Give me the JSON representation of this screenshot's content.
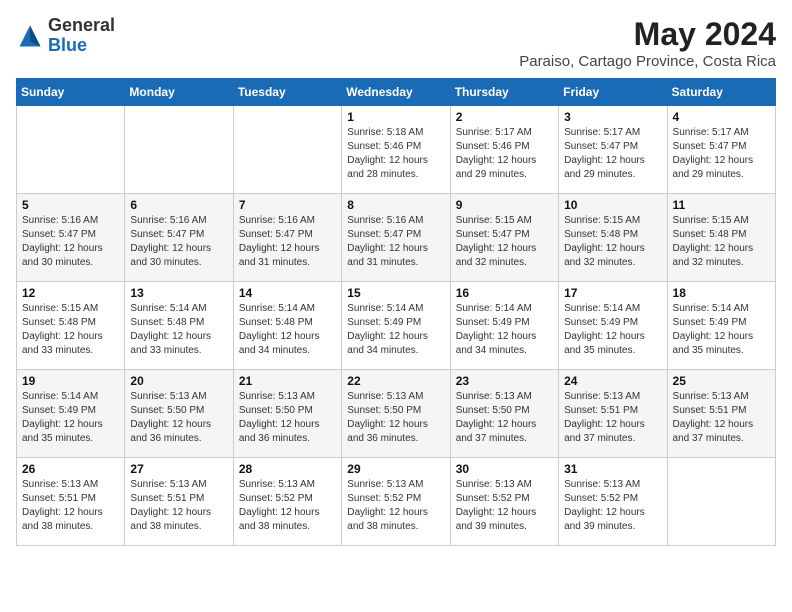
{
  "header": {
    "logo_general": "General",
    "logo_blue": "Blue",
    "month_year": "May 2024",
    "location": "Paraiso, Cartago Province, Costa Rica"
  },
  "days_of_week": [
    "Sunday",
    "Monday",
    "Tuesday",
    "Wednesday",
    "Thursday",
    "Friday",
    "Saturday"
  ],
  "weeks": [
    [
      {
        "day": "",
        "sunrise": "",
        "sunset": "",
        "daylight": ""
      },
      {
        "day": "",
        "sunrise": "",
        "sunset": "",
        "daylight": ""
      },
      {
        "day": "",
        "sunrise": "",
        "sunset": "",
        "daylight": ""
      },
      {
        "day": "1",
        "sunrise": "Sunrise: 5:18 AM",
        "sunset": "Sunset: 5:46 PM",
        "daylight": "Daylight: 12 hours and 28 minutes."
      },
      {
        "day": "2",
        "sunrise": "Sunrise: 5:17 AM",
        "sunset": "Sunset: 5:46 PM",
        "daylight": "Daylight: 12 hours and 29 minutes."
      },
      {
        "day": "3",
        "sunrise": "Sunrise: 5:17 AM",
        "sunset": "Sunset: 5:47 PM",
        "daylight": "Daylight: 12 hours and 29 minutes."
      },
      {
        "day": "4",
        "sunrise": "Sunrise: 5:17 AM",
        "sunset": "Sunset: 5:47 PM",
        "daylight": "Daylight: 12 hours and 29 minutes."
      }
    ],
    [
      {
        "day": "5",
        "sunrise": "Sunrise: 5:16 AM",
        "sunset": "Sunset: 5:47 PM",
        "daylight": "Daylight: 12 hours and 30 minutes."
      },
      {
        "day": "6",
        "sunrise": "Sunrise: 5:16 AM",
        "sunset": "Sunset: 5:47 PM",
        "daylight": "Daylight: 12 hours and 30 minutes."
      },
      {
        "day": "7",
        "sunrise": "Sunrise: 5:16 AM",
        "sunset": "Sunset: 5:47 PM",
        "daylight": "Daylight: 12 hours and 31 minutes."
      },
      {
        "day": "8",
        "sunrise": "Sunrise: 5:16 AM",
        "sunset": "Sunset: 5:47 PM",
        "daylight": "Daylight: 12 hours and 31 minutes."
      },
      {
        "day": "9",
        "sunrise": "Sunrise: 5:15 AM",
        "sunset": "Sunset: 5:47 PM",
        "daylight": "Daylight: 12 hours and 32 minutes."
      },
      {
        "day": "10",
        "sunrise": "Sunrise: 5:15 AM",
        "sunset": "Sunset: 5:48 PM",
        "daylight": "Daylight: 12 hours and 32 minutes."
      },
      {
        "day": "11",
        "sunrise": "Sunrise: 5:15 AM",
        "sunset": "Sunset: 5:48 PM",
        "daylight": "Daylight: 12 hours and 32 minutes."
      }
    ],
    [
      {
        "day": "12",
        "sunrise": "Sunrise: 5:15 AM",
        "sunset": "Sunset: 5:48 PM",
        "daylight": "Daylight: 12 hours and 33 minutes."
      },
      {
        "day": "13",
        "sunrise": "Sunrise: 5:14 AM",
        "sunset": "Sunset: 5:48 PM",
        "daylight": "Daylight: 12 hours and 33 minutes."
      },
      {
        "day": "14",
        "sunrise": "Sunrise: 5:14 AM",
        "sunset": "Sunset: 5:48 PM",
        "daylight": "Daylight: 12 hours and 34 minutes."
      },
      {
        "day": "15",
        "sunrise": "Sunrise: 5:14 AM",
        "sunset": "Sunset: 5:49 PM",
        "daylight": "Daylight: 12 hours and 34 minutes."
      },
      {
        "day": "16",
        "sunrise": "Sunrise: 5:14 AM",
        "sunset": "Sunset: 5:49 PM",
        "daylight": "Daylight: 12 hours and 34 minutes."
      },
      {
        "day": "17",
        "sunrise": "Sunrise: 5:14 AM",
        "sunset": "Sunset: 5:49 PM",
        "daylight": "Daylight: 12 hours and 35 minutes."
      },
      {
        "day": "18",
        "sunrise": "Sunrise: 5:14 AM",
        "sunset": "Sunset: 5:49 PM",
        "daylight": "Daylight: 12 hours and 35 minutes."
      }
    ],
    [
      {
        "day": "19",
        "sunrise": "Sunrise: 5:14 AM",
        "sunset": "Sunset: 5:49 PM",
        "daylight": "Daylight: 12 hours and 35 minutes."
      },
      {
        "day": "20",
        "sunrise": "Sunrise: 5:13 AM",
        "sunset": "Sunset: 5:50 PM",
        "daylight": "Daylight: 12 hours and 36 minutes."
      },
      {
        "day": "21",
        "sunrise": "Sunrise: 5:13 AM",
        "sunset": "Sunset: 5:50 PM",
        "daylight": "Daylight: 12 hours and 36 minutes."
      },
      {
        "day": "22",
        "sunrise": "Sunrise: 5:13 AM",
        "sunset": "Sunset: 5:50 PM",
        "daylight": "Daylight: 12 hours and 36 minutes."
      },
      {
        "day": "23",
        "sunrise": "Sunrise: 5:13 AM",
        "sunset": "Sunset: 5:50 PM",
        "daylight": "Daylight: 12 hours and 37 minutes."
      },
      {
        "day": "24",
        "sunrise": "Sunrise: 5:13 AM",
        "sunset": "Sunset: 5:51 PM",
        "daylight": "Daylight: 12 hours and 37 minutes."
      },
      {
        "day": "25",
        "sunrise": "Sunrise: 5:13 AM",
        "sunset": "Sunset: 5:51 PM",
        "daylight": "Daylight: 12 hours and 37 minutes."
      }
    ],
    [
      {
        "day": "26",
        "sunrise": "Sunrise: 5:13 AM",
        "sunset": "Sunset: 5:51 PM",
        "daylight": "Daylight: 12 hours and 38 minutes."
      },
      {
        "day": "27",
        "sunrise": "Sunrise: 5:13 AM",
        "sunset": "Sunset: 5:51 PM",
        "daylight": "Daylight: 12 hours and 38 minutes."
      },
      {
        "day": "28",
        "sunrise": "Sunrise: 5:13 AM",
        "sunset": "Sunset: 5:52 PM",
        "daylight": "Daylight: 12 hours and 38 minutes."
      },
      {
        "day": "29",
        "sunrise": "Sunrise: 5:13 AM",
        "sunset": "Sunset: 5:52 PM",
        "daylight": "Daylight: 12 hours and 38 minutes."
      },
      {
        "day": "30",
        "sunrise": "Sunrise: 5:13 AM",
        "sunset": "Sunset: 5:52 PM",
        "daylight": "Daylight: 12 hours and 39 minutes."
      },
      {
        "day": "31",
        "sunrise": "Sunrise: 5:13 AM",
        "sunset": "Sunset: 5:52 PM",
        "daylight": "Daylight: 12 hours and 39 minutes."
      },
      {
        "day": "",
        "sunrise": "",
        "sunset": "",
        "daylight": ""
      }
    ]
  ]
}
